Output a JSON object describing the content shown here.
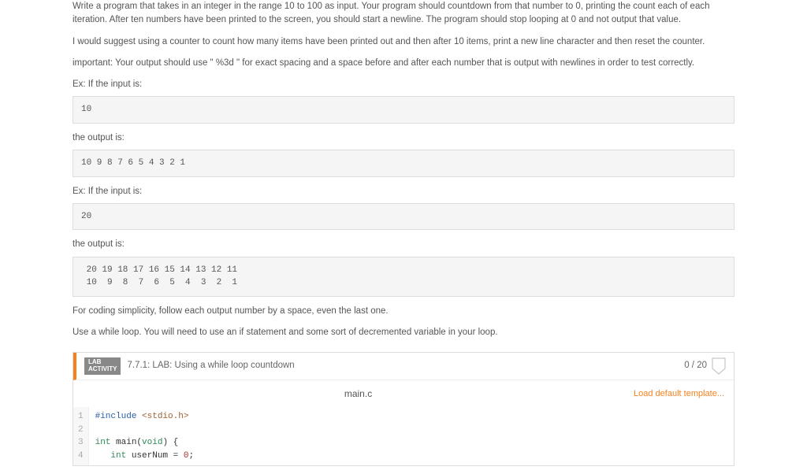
{
  "instructions": {
    "para1": "Write a program that takes in an integer in the range 10 to 100 as input. Your program should countdown from that number to 0, printing the count each of each iteration. After ten numbers have been printed to the screen, you should start a newline. The program should stop looping at 0 and not output that value.",
    "para2": "I would suggest using a counter to count how many items have been printed out and then after 10 items, print a new line character and then reset the counter.",
    "para3": "important: Your output should use \" %3d \" for exact spacing and a space before and after each number that is output with newlines in order to test correctly.",
    "ex1_label": "Ex: If the input is:",
    "ex1_input": "10",
    "ex1_output_label": "the output is:",
    "ex1_output": "10 9 8 7 6 5 4 3 2 1",
    "ex2_label": "Ex: If the input is:",
    "ex2_input": "20",
    "ex2_output_label": "the output is:",
    "ex2_output": " 20 19 18 17 16 15 14 13 12 11\n 10  9  8  7  6  5  4  3  2  1",
    "final1": "For coding simplicity, follow each output number by a space, even the last one.",
    "final2": "Use a while loop. You will need to use an if statement and some sort of decremented variable in your loop."
  },
  "lab": {
    "badge_line1": "LAB",
    "badge_line2": "ACTIVITY",
    "title": "7.7.1: LAB: Using a while loop countdown",
    "score": "0 / 20",
    "file_name": "main.c",
    "load_template_label": "Load default template..."
  },
  "editor": {
    "gutter": "1\n2\n3\n4",
    "code_plain": "#include <stdio.h>\n\nint main(void) {\n   int userNum = 0;",
    "line1_prefix": "#include ",
    "line1_lib": "<stdio.h>",
    "line3_kw1": "int",
    "line3_rest": " main(",
    "line3_kw2": "void",
    "line3_end": ") {",
    "line4_indent": "   ",
    "line4_kw": "int",
    "line4_rest": " userNum = ",
    "line4_num": "0",
    "line4_end": ";"
  }
}
